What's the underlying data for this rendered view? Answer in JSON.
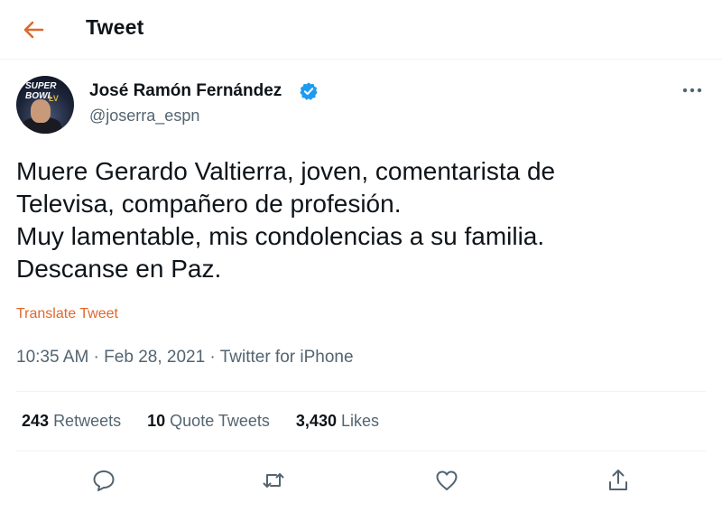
{
  "header": {
    "title": "Tweet",
    "back_icon": "arrow-left-icon",
    "accent": "#e0672c"
  },
  "author": {
    "name": "José Ramón Fernández",
    "handle": "@joserra_espn",
    "verified_icon": "verified-badge-icon",
    "verified_color": "#1d9bf0",
    "avatar_text_top": "SUPER BOWL",
    "avatar_text_badge": "LV"
  },
  "tweet": {
    "lines": [
      "Muere Gerardo Valtierra, joven, comentarista de",
      "Televisa, compañero de profesión.",
      "Muy lamentable, mis condolencias a su familia.",
      "Descanse en Paz."
    ],
    "translate_label": "Translate Tweet"
  },
  "meta": {
    "time": "10:35 AM",
    "separator": " · ",
    "date": "Feb 28, 2021",
    "source": "Twitter for iPhone"
  },
  "stats": {
    "retweets_count": "243",
    "retweets_label": "Retweets",
    "quotes_count": "10",
    "quotes_label": "Quote Tweets",
    "likes_count": "3,430",
    "likes_label": "Likes"
  },
  "actions": [
    "reply-icon",
    "retweet-icon",
    "like-icon",
    "share-icon"
  ]
}
